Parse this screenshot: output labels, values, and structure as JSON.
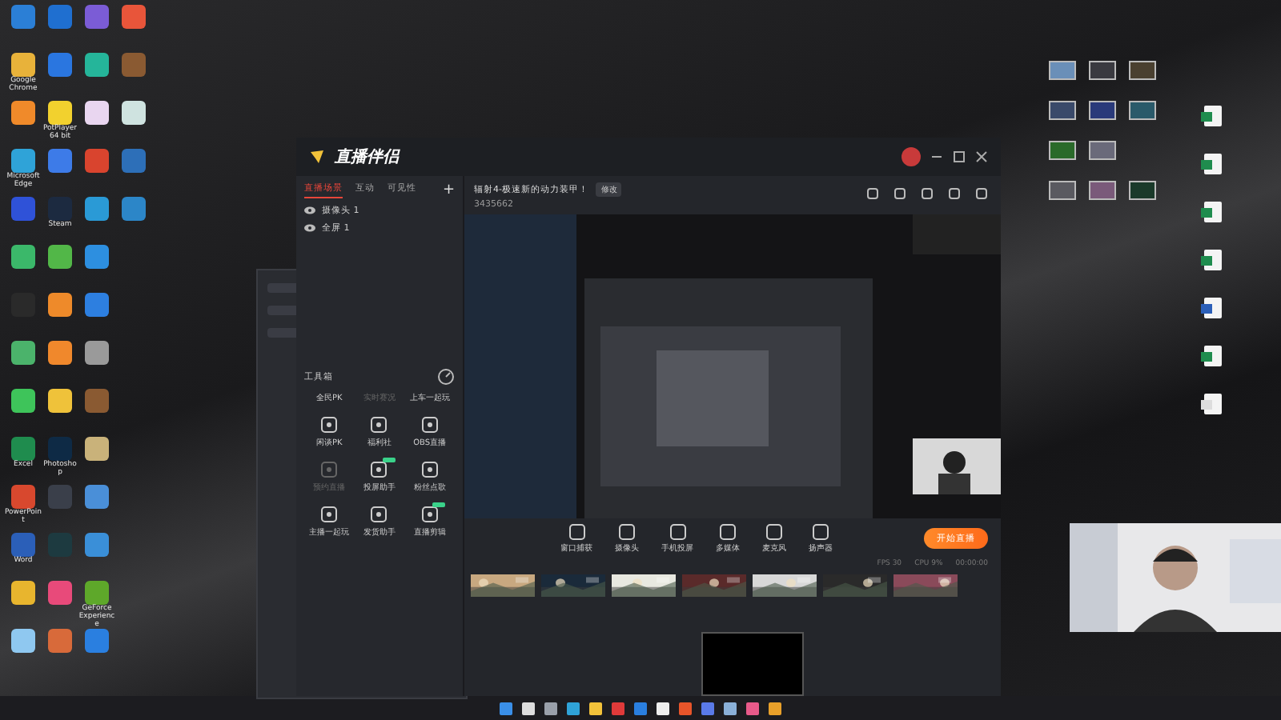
{
  "desktop_left": [
    [
      {
        "color": "#2b7fd6"
      },
      {
        "color": "#1f6fd0"
      },
      {
        "color": "#7b5cd6"
      },
      {
        "color": "#e8553a"
      }
    ],
    [
      {
        "color": "#e8b23a",
        "label": "Google Chrome"
      },
      {
        "color": "#2a76e0"
      },
      {
        "color": "#25b59a"
      },
      {
        "color": "#8a5a32"
      }
    ],
    [
      {
        "color": "#f08a2a"
      },
      {
        "color": "#f2d12e",
        "label": "PotPlayer 64 bit"
      },
      {
        "color": "#e9d6f0"
      },
      {
        "color": "#cfe3e0"
      }
    ],
    [
      {
        "color": "#2fa3d8",
        "label": "Microsoft Edge"
      },
      {
        "color": "#3d7be8"
      },
      {
        "color": "#d9442e"
      },
      {
        "color": "#2d6fb8"
      }
    ],
    [
      {
        "color": "#2f52d8"
      },
      {
        "color": "#1c2a40",
        "label": "Steam"
      },
      {
        "color": "#2a9ad6"
      },
      {
        "color": "#2c86c8"
      }
    ],
    [
      {
        "color": "#3bb86a"
      },
      {
        "color": "#52b748"
      },
      {
        "color": "#2d8fe0"
      }
    ],
    [
      {
        "color": "#2a2a2a"
      },
      {
        "color": "#ee8a2a"
      },
      {
        "color": "#2d7fe0"
      }
    ],
    [
      {
        "color": "#4bb36b"
      },
      {
        "color": "#f0882c"
      },
      {
        "color": "#9a9a9a"
      }
    ],
    [
      {
        "color": "#3ec45a"
      },
      {
        "color": "#efc23a"
      },
      {
        "color": "#8a5a32"
      }
    ],
    [
      {
        "color": "#1f8c4e",
        "label": "Excel"
      },
      {
        "color": "#0e2a45",
        "label": "Photoshop"
      },
      {
        "color": "#c9b27a"
      }
    ],
    [
      {
        "color": "#d8482e",
        "label": "PowerPoint"
      },
      {
        "color": "#3a3f4a"
      },
      {
        "color": "#4a8fd8"
      }
    ],
    [
      {
        "color": "#2b5fb8",
        "label": "Word"
      },
      {
        "color": "#1d3a40"
      },
      {
        "color": "#3a8fd8"
      }
    ],
    [
      {
        "color": "#e8b52e"
      },
      {
        "color": "#e84a7a"
      },
      {
        "color": "#5ea82a",
        "label": "GeForce Experience"
      }
    ],
    [
      {
        "color": "#8fc8f0"
      },
      {
        "color": "#d86a3a"
      },
      {
        "color": "#2a7fe0"
      }
    ]
  ],
  "desktop_thumbs": [
    [
      {
        "color": "#6a8fb8"
      },
      {
        "color": "#3a3a40"
      },
      {
        "color": "#4a4030"
      }
    ],
    [
      {
        "color": "#3a4a6a"
      },
      {
        "color": "#2a3a7a"
      },
      {
        "color": "#2a5a6a"
      }
    ],
    [
      {
        "color": "#2a6a2a"
      },
      {
        "color": "#6a6a7a"
      }
    ],
    [
      {
        "color": "#5a5a60"
      },
      {
        "color": "#7a5a7a"
      },
      {
        "color": "#1a3a2a"
      }
    ]
  ],
  "desktop_docs": [
    {
      "color": "#1f8c4e"
    },
    {
      "color": "#1f8c4e"
    },
    {
      "color": "#1f8c4e"
    },
    {
      "color": "#1f8c4e"
    },
    {
      "color": "#2b5fb8"
    },
    {
      "color": "#1f8c4e"
    },
    {
      "color": "#dddddd"
    }
  ],
  "app": {
    "title": "直播伴侣",
    "tabs": [
      {
        "label": "直播场景",
        "selected": true
      },
      {
        "label": "互动",
        "selected": false
      },
      {
        "label": "可见性",
        "selected": false
      }
    ],
    "add": "+",
    "sources": [
      {
        "label": "摄像头 1"
      },
      {
        "label": "全屏 1"
      }
    ],
    "toolbox_title": "工具箱",
    "tools": [
      {
        "label": "全民PK",
        "disabled": false,
        "new": false,
        "icon": false
      },
      {
        "label": "实时赛况",
        "disabled": true,
        "new": false,
        "icon": false
      },
      {
        "label": "上车一起玩",
        "disabled": false,
        "new": false,
        "icon": false
      },
      {
        "label": "闲谈PK",
        "disabled": false,
        "new": false,
        "icon": true
      },
      {
        "label": "福利社",
        "disabled": false,
        "new": false,
        "icon": true
      },
      {
        "label": "OBS直播",
        "disabled": false,
        "new": false,
        "icon": true
      },
      {
        "label": "预约直播",
        "disabled": true,
        "new": false,
        "icon": true
      },
      {
        "label": "投屏助手",
        "disabled": false,
        "new": true,
        "icon": true
      },
      {
        "label": "粉丝点歌",
        "disabled": false,
        "new": false,
        "icon": true
      },
      {
        "label": "主播一起玩",
        "disabled": false,
        "new": false,
        "icon": true
      },
      {
        "label": "发货助手",
        "disabled": false,
        "new": false,
        "icon": true
      },
      {
        "label": "直播剪辑",
        "disabled": false,
        "new": true,
        "icon": true
      }
    ],
    "stream_title": "辐射4-极速新的动力装甲！",
    "edit": "修改",
    "room": "3435662",
    "controls": [
      {
        "label": "窗口捕获"
      },
      {
        "label": "摄像头"
      },
      {
        "label": "手机投屏"
      },
      {
        "label": "多媒体"
      },
      {
        "label": "麦克风"
      },
      {
        "label": "扬声器"
      }
    ],
    "start": "开始直播",
    "stats": [
      "FPS 30",
      "CPU 9%"
    ],
    "timer": "00:00:00",
    "thumbnails": [
      {
        "kind": "picture"
      },
      {
        "kind": "picture"
      },
      {
        "kind": "picture"
      },
      {
        "kind": "picture"
      },
      {
        "kind": "picture"
      },
      {
        "kind": "picture"
      },
      {
        "kind": "picture"
      }
    ]
  },
  "taskbar": {
    "apps": [
      {
        "color": "#3a8fe8"
      },
      {
        "color": "#dddddd"
      },
      {
        "color": "#9aa0aa"
      },
      {
        "color": "#2fa3d8"
      },
      {
        "color": "#f2c23a"
      },
      {
        "color": "#e03a3a"
      },
      {
        "color": "#2a7fe0"
      },
      {
        "color": "#eeeeee"
      },
      {
        "color": "#e8552a"
      },
      {
        "color": "#5a7ae8"
      },
      {
        "color": "#8ab0d8"
      },
      {
        "color": "#e85a8a"
      },
      {
        "color": "#e8a02a"
      }
    ]
  }
}
